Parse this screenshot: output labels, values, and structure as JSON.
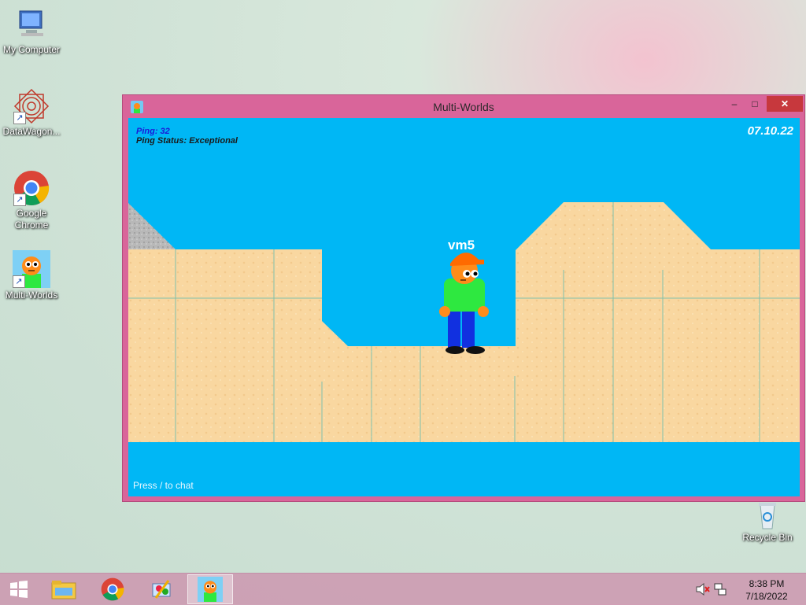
{
  "desktop": {
    "icons": [
      {
        "label": "My Computer"
      },
      {
        "label": "DataWagon..."
      },
      {
        "label": "Google Chrome"
      },
      {
        "label": "Multi-Worlds"
      },
      {
        "label": "Recycle Bin"
      }
    ]
  },
  "window": {
    "title": "Multi-Worlds",
    "minimize_glyph": "–",
    "maximize_glyph": "□",
    "close_glyph": "✕"
  },
  "game": {
    "ping": "Ping: 32",
    "ping_status": "Ping Status: Exceptional",
    "date": "07.10.22",
    "player_name": "vm5",
    "chat_hint": "Press / to chat"
  },
  "taskbar": {
    "items": [
      {
        "icon": "windows-start-icon"
      },
      {
        "icon": "file-explorer-icon"
      },
      {
        "icon": "chrome-icon"
      },
      {
        "icon": "control-panel-icon"
      },
      {
        "icon": "multi-worlds-icon",
        "active": true
      }
    ],
    "clock_time": "8:38 PM",
    "clock_date": "7/18/2022"
  },
  "colors": {
    "sky": "#00b7f5",
    "sand": "#f9d7a0",
    "window_border": "#d9659a",
    "close_red": "#c7383d"
  }
}
